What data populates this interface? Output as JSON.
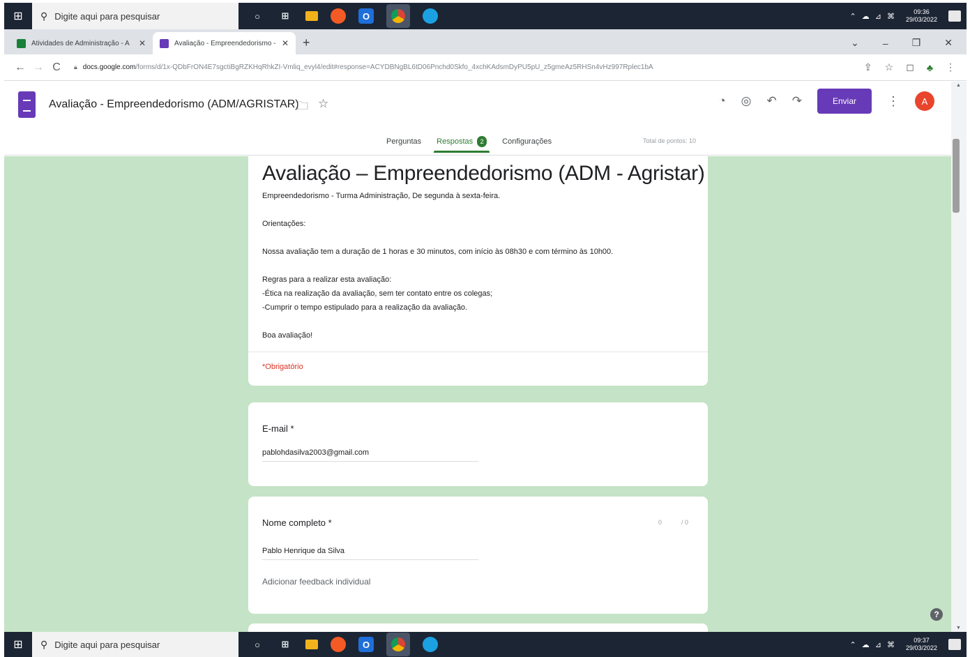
{
  "taskbar_top": {
    "search_placeholder": "Digite aqui para pesquisar",
    "clock_time": "09:36",
    "clock_date": "29/03/2022"
  },
  "taskbar_bottom": {
    "search_placeholder": "Digite aqui para pesquisar",
    "clock_time": "09:37",
    "clock_date": "29/03/2022"
  },
  "taskbar_apps": [
    "task-view-icon",
    "file-explorer-icon",
    "firefox-icon",
    "outlook-icon",
    "chrome-icon",
    "edge-icon"
  ],
  "browser": {
    "tabs": [
      {
        "title": "Atividades de Administração - A",
        "favicon_color": "#188038"
      },
      {
        "title": "Avaliação - Empreendedorismo -",
        "favicon_color": "#673ab7"
      }
    ],
    "url_domain": "docs.google.com",
    "url_path": "/forms/d/1x-QDbFrON4E7sgctiBgRZKHqRhkZI-Vmliq_evyl4/edit#response=ACYDBNgBL6tD06Pnchd0Skfo_4xchKAdsmDyPU5pU_z5gmeAz5RHSn4vHz997Rplec1bA"
  },
  "forms_header": {
    "doc_title": "Avaliação - Empreendedorismo (ADM/AGRISTAR)",
    "send_label": "Enviar",
    "avatar_letter": "A",
    "tabs": [
      {
        "label": "Perguntas"
      },
      {
        "label": "Respostas",
        "badge": "2"
      },
      {
        "label": "Configurações"
      }
    ],
    "total_points": "Total de pontos: 10"
  },
  "form": {
    "title": "Avaliação – Empreendedorismo (ADM - Agristar)",
    "description_lines": [
      "Empreendedorismo - Turma Administração, De segunda à sexta-feira.",
      "Orientações:",
      "Nossa avaliação tem a duração de  1 horas e 30 minutos, com início às 08h30 e com término às 10h00.",
      "Regras para a realizar esta avaliação:",
      "-Ética na realização da avaliação, sem ter contato entre os colegas;",
      "-Cumprir o tempo estipulado para a realização da avaliação.",
      "Boa avaliação!"
    ],
    "required_note": "*Obrigatório",
    "questions": [
      {
        "label": "E-mail *",
        "answer": "pablohdasilva2003@gmail.com"
      },
      {
        "label": "Nome completo *",
        "answer": "Pablo Henrique da Silva",
        "feedback": "Adicionar feedback individual",
        "points_left": "0",
        "points_right": "/ 0"
      }
    ]
  }
}
